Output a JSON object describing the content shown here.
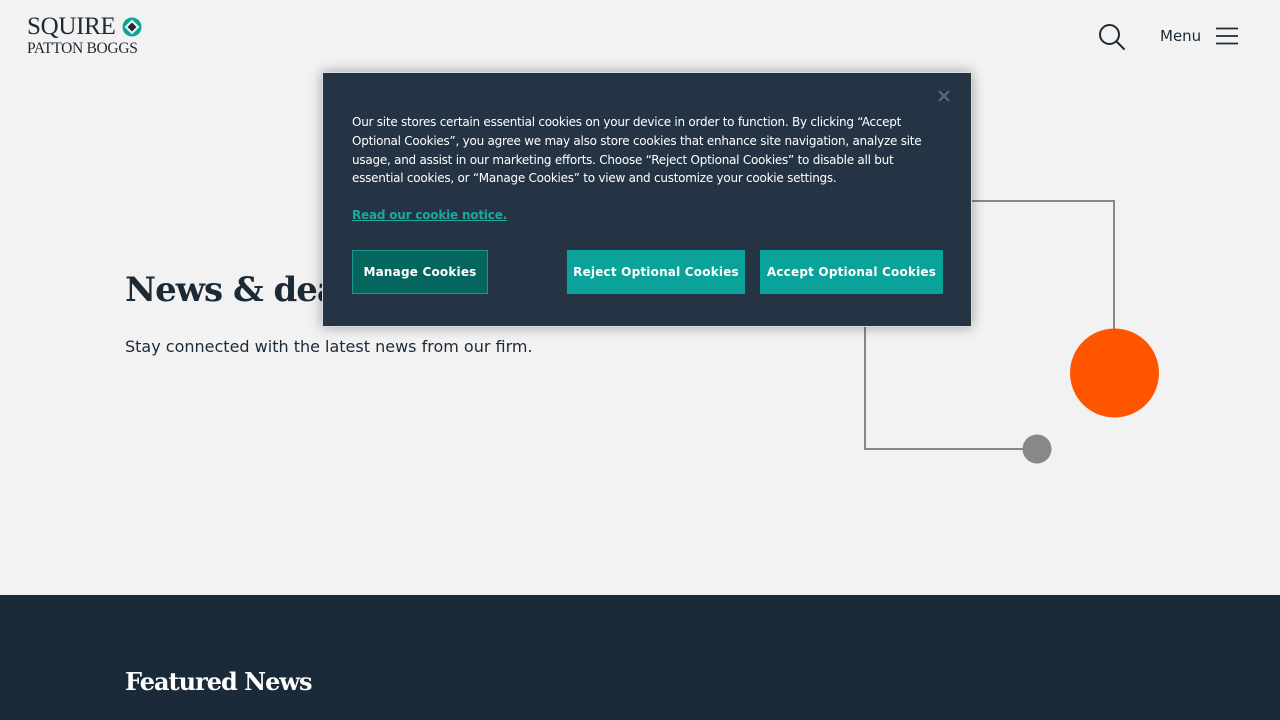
{
  "header": {
    "logo_top": "SQUIRE",
    "logo_bottom": "PATTON BOGGS",
    "search_icon": "search-icon",
    "menu_label": "Menu",
    "menu_icon": "hamburger-icon"
  },
  "hero": {
    "title": "News & deals",
    "subtitle": "Stay connected with the latest news from our firm."
  },
  "featured": {
    "title": "Featured News"
  },
  "cookie_banner": {
    "text": "Our site stores certain essential cookies on your device in order to function. By clicking “Accept Optional Cookies”, you agree we may also store cookies that enhance site navigation, analyze site usage, and assist in our marketing efforts. Choose “Reject Optional Cookies” to disable all but essential cookies, or “Manage Cookies” to view and customize your cookie settings.",
    "link_label": "Read our cookie notice.",
    "manage_label": "Manage Cookies",
    "reject_label": "Reject Optional Cookies",
    "accept_label": "Accept Optional Cookies",
    "close_icon": "close-icon"
  },
  "colors": {
    "background": "#f2f2f2",
    "dark_navy": "#1b2a38",
    "banner_bg": "#243444",
    "teal": "#0aa39a",
    "dark_teal": "#05655f",
    "orange": "#ff5500",
    "gray": "#888888"
  }
}
